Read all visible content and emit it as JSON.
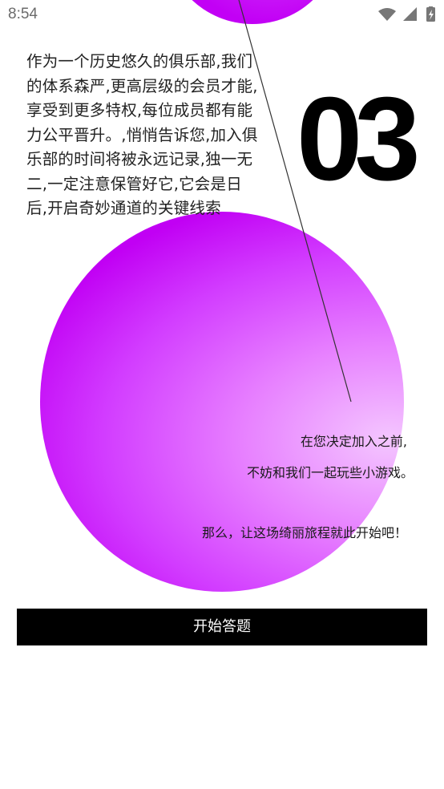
{
  "status_bar": {
    "time": "8:54",
    "icons": [
      "wifi-icon",
      "cellular-signal-icon",
      "battery-charging-icon"
    ]
  },
  "intro": {
    "text": "作为一个历史悠久的俱乐部,我们的体系森严,更高层级的会员才能,享受到更多特权,每位成员都有能力公平晋升。,悄悄告诉您,加入俱乐部的时间将被永远记录,独一无二,一定注意保管好它,它会是日后,开启奇妙通道的关键线索"
  },
  "number": "03",
  "messages": {
    "line1": "在您决定加入之前,",
    "line2": "不妨和我们一起玩些小游戏。",
    "line3": "那么，让这场绮丽旅程就此开始吧！"
  },
  "button": {
    "label": "开始答题"
  },
  "colors": {
    "accent_purple": "#c000f2",
    "light_purple": "#f4c6ff",
    "button_bg": "#000000",
    "button_text": "#ffffff"
  }
}
